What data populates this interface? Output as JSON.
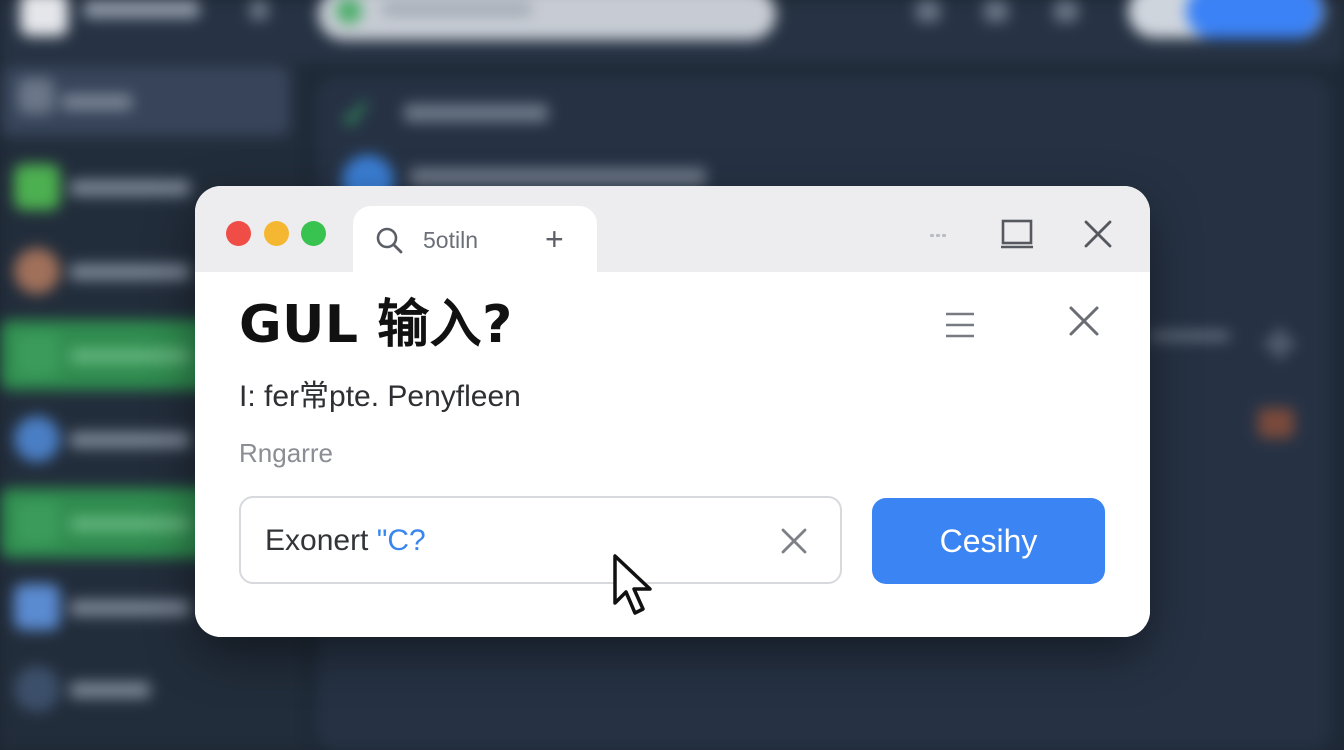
{
  "dialog": {
    "tab": {
      "label": "5otiln",
      "search_icon": "search-icon",
      "new_tab_icon": "plus-icon"
    },
    "window_controls": [
      "minimize-icon",
      "maximize-icon",
      "close-icon"
    ],
    "heading": "GUL 输入?",
    "description": "I: fer常pte. Penyfl‌een",
    "field_label": "Rngarre",
    "input": {
      "value_prefix": "Exonert ",
      "value_accent": "\"C?"
    },
    "primary_button_label": "Cesihy",
    "colors": {
      "accent": "#3b84f3",
      "traffic_red": "#ef4d46",
      "traffic_yellow": "#f5b731",
      "traffic_green": "#38c24f"
    }
  }
}
